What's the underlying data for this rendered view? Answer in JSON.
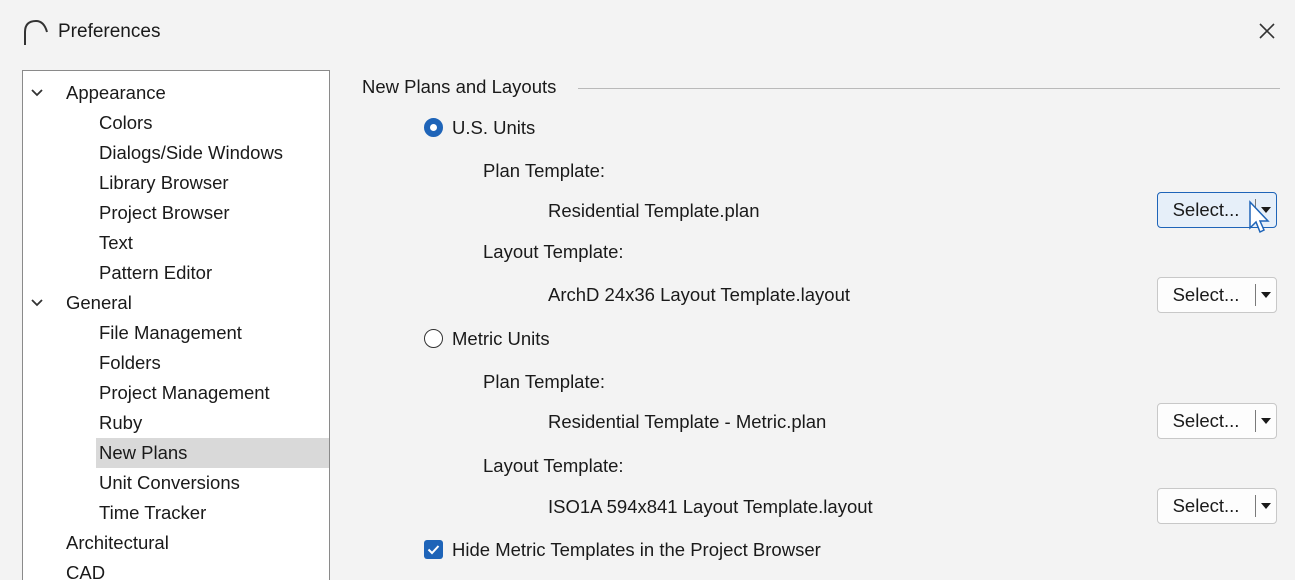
{
  "window": {
    "title": "Preferences"
  },
  "tree": {
    "items": [
      {
        "label": "Appearance"
      },
      {
        "label": "Colors"
      },
      {
        "label": "Dialogs/Side Windows"
      },
      {
        "label": "Library Browser"
      },
      {
        "label": "Project Browser"
      },
      {
        "label": "Text"
      },
      {
        "label": "Pattern Editor"
      },
      {
        "label": "General"
      },
      {
        "label": "File Management"
      },
      {
        "label": "Folders"
      },
      {
        "label": "Project Management"
      },
      {
        "label": "Ruby"
      },
      {
        "label": "New Plans"
      },
      {
        "label": "Unit Conversions"
      },
      {
        "label": "Time Tracker"
      },
      {
        "label": "Architectural"
      },
      {
        "label": "CAD"
      }
    ],
    "selected": "New Plans"
  },
  "panel": {
    "section_title": "New Plans and Layouts",
    "us_units": {
      "label": "U.S. Units",
      "checked": true,
      "plan_label": "Plan Template:",
      "plan_value": "Residential Template.plan",
      "layout_label": "Layout Template:",
      "layout_value": "ArchD 24x36 Layout Template.layout"
    },
    "metric_units": {
      "label": "Metric Units",
      "checked": false,
      "plan_label": "Plan Template:",
      "plan_value": "Residential Template - Metric.plan",
      "layout_label": "Layout Template:",
      "layout_value": "ISO1A 594x841 Layout Template.layout"
    },
    "select_label": "Select...",
    "hide_metric": {
      "label": "Hide Metric Templates in the Project Browser",
      "checked": true
    }
  },
  "colors": {
    "accent": "#1e64b8",
    "selection": "#d9d9d9"
  }
}
